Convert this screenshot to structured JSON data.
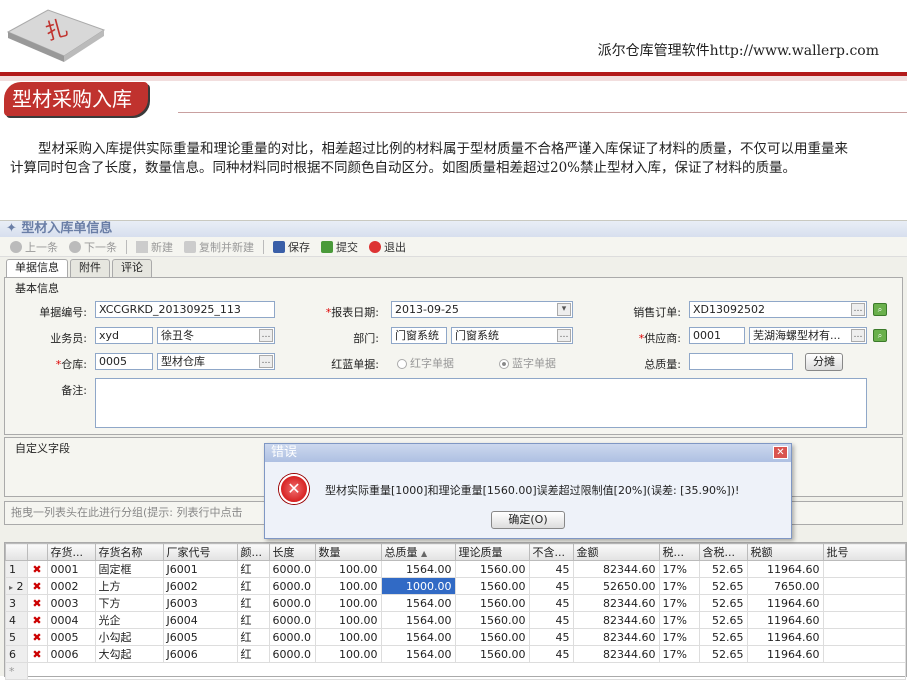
{
  "slide": {
    "header_right": "派尔仓库管理软件http://www.wallerp.com",
    "title": "型材采购入库",
    "intro": "型材采购入库提供实际重量和理论重量的对比，相差超过比例的材料属于型材质量不合格严谨入库保证了材料的质量，不仅可以用重量来计算同时包含了长度，数量信息。同种材料同时根据不同颜色自动区分。如图质量相差超过20%禁止型材入库，保证了材料的质量。"
  },
  "app": {
    "window_title": "型材入库单信息",
    "toolbar": [
      {
        "label": "上一条",
        "icon": "arrow-left-icon",
        "enabled": false
      },
      {
        "label": "下一条",
        "icon": "arrow-right-icon",
        "enabled": false
      },
      {
        "label": "新建",
        "icon": "plus-icon",
        "enabled": false
      },
      {
        "label": "复制并新建",
        "icon": "copy-icon",
        "enabled": false
      },
      {
        "label": "保存",
        "icon": "save-icon",
        "enabled": true
      },
      {
        "label": "提交",
        "icon": "submit-icon",
        "enabled": true
      },
      {
        "label": "退出",
        "icon": "exit-icon",
        "enabled": true
      }
    ],
    "tabs": [
      "单据信息",
      "附件",
      "评论"
    ],
    "form": {
      "group_title": "基本信息",
      "doc_no_label": "单据编号:",
      "doc_no": "XCCGRKD_20130925_113",
      "report_date_label": "报表日期:",
      "report_date": "2013-09-25",
      "sales_order_label": "销售订单:",
      "sales_order": "XD13092502",
      "clerk_label": "业务员:",
      "clerk_code": "xyd",
      "clerk_name": "徐丑冬",
      "dept_label": "部门:",
      "dept_code": "门窗系统",
      "dept_name": "门窗系统",
      "supplier_label": "供应商:",
      "supplier_code": "0001",
      "supplier_name": "芜湖海螺型材有...",
      "warehouse_label": "仓库:",
      "warehouse_code": "0005",
      "warehouse_name": "型材仓库",
      "redblue_label": "红蓝单据:",
      "red_option": "红字单据",
      "blue_option": "蓝字单据",
      "total_weight_label": "总质量:",
      "total_weight": "",
      "split_button": "分摊",
      "note_label": "备注:",
      "note": ""
    },
    "custom_fields_title": "自定义字段",
    "group_hint": "拖曳一列表头在此进行分组(提示: 列表行中点击",
    "grid": {
      "columns": [
        "",
        "",
        "存货...",
        "存货名称",
        "厂家代号",
        "颜...",
        "长度",
        "数量",
        "总质量",
        "理论质量",
        "不含...",
        "金额",
        "税...",
        "含税...",
        "税额",
        "批号"
      ],
      "rows": [
        {
          "n": "1",
          "code": "0001",
          "name": "固定框",
          "mfr": "J6001",
          "color": "红",
          "len": "6000.0",
          "qty": "100.00",
          "wt": "1564.00",
          "twt": "1560.00",
          "price": "45",
          "amt": "82344.60",
          "tax": "17%",
          "tprice": "52.65",
          "taxamt": "11964.60",
          "batch": ""
        },
        {
          "n": "2",
          "code": "0002",
          "name": "上方",
          "mfr": "J6002",
          "color": "红",
          "len": "6000.0",
          "qty": "100.00",
          "wt": "1000.00",
          "twt": "1560.00",
          "price": "45",
          "amt": "52650.00",
          "tax": "17%",
          "tprice": "52.65",
          "taxamt": "7650.00",
          "batch": ""
        },
        {
          "n": "3",
          "code": "0003",
          "name": "下方",
          "mfr": "J6003",
          "color": "红",
          "len": "6000.0",
          "qty": "100.00",
          "wt": "1564.00",
          "twt": "1560.00",
          "price": "45",
          "amt": "82344.60",
          "tax": "17%",
          "tprice": "52.65",
          "taxamt": "11964.60",
          "batch": ""
        },
        {
          "n": "4",
          "code": "0004",
          "name": "光企",
          "mfr": "J6004",
          "color": "红",
          "len": "6000.0",
          "qty": "100.00",
          "wt": "1564.00",
          "twt": "1560.00",
          "price": "45",
          "amt": "82344.60",
          "tax": "17%",
          "tprice": "52.65",
          "taxamt": "11964.60",
          "batch": ""
        },
        {
          "n": "5",
          "code": "0005",
          "name": "小勾起",
          "mfr": "J6005",
          "color": "红",
          "len": "6000.0",
          "qty": "100.00",
          "wt": "1564.00",
          "twt": "1560.00",
          "price": "45",
          "amt": "82344.60",
          "tax": "17%",
          "tprice": "52.65",
          "taxamt": "11964.60",
          "batch": ""
        },
        {
          "n": "6",
          "code": "0006",
          "name": "大勾起",
          "mfr": "J6006",
          "color": "红",
          "len": "6000.0",
          "qty": "100.00",
          "wt": "1564.00",
          "twt": "1560.00",
          "price": "45",
          "amt": "82344.60",
          "tax": "17%",
          "tprice": "52.65",
          "taxamt": "11964.60",
          "batch": ""
        }
      ]
    },
    "dialog": {
      "title": "错误",
      "message": "型材实际重量[1000]和理论重量[1560.00]误差超过限制值[20%](误差: [35.90%])!",
      "ok_button": "确定(O)"
    }
  }
}
